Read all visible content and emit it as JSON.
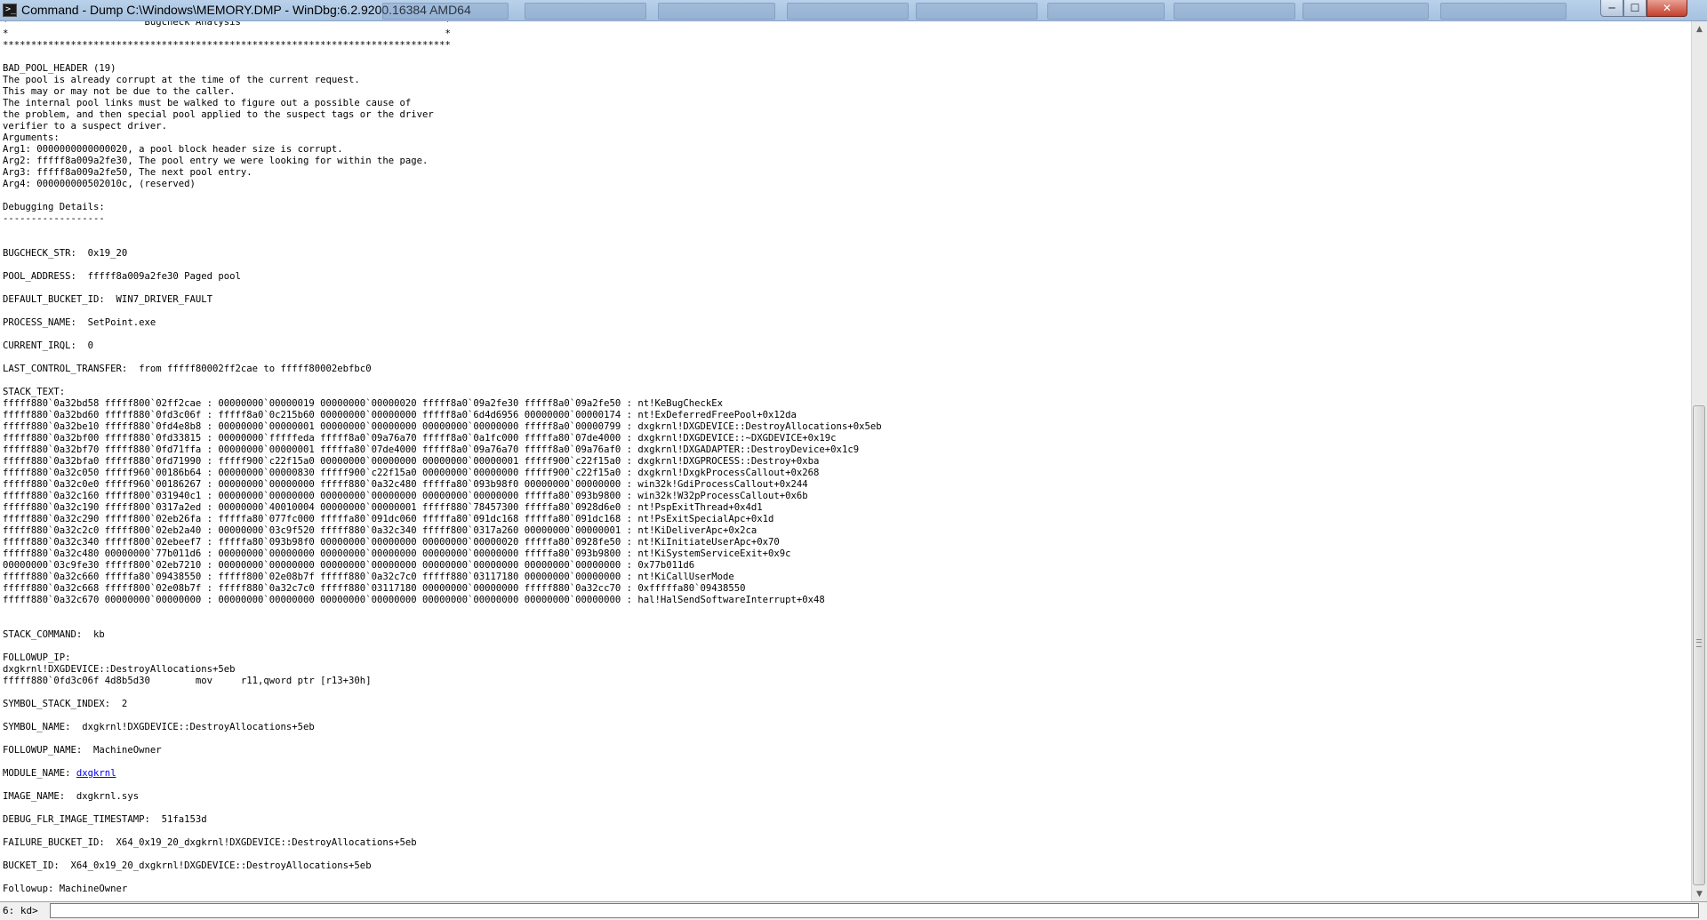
{
  "window": {
    "title": "Command - Dump C:\\Windows\\MEMORY.DMP - WinDbg:6.2.9200.16384 AMD64",
    "icon_glyph": ">_",
    "minimize_glyph": "─",
    "maximize_glyph": "☐",
    "close_glyph": "✕"
  },
  "output": {
    "text_before_link": "*                        Bugcheck Analysis                                    *\n*                                                                             *\n*******************************************************************************\n\nBAD_POOL_HEADER (19)\nThe pool is already corrupt at the time of the current request.\nThis may or may not be due to the caller.\nThe internal pool links must be walked to figure out a possible cause of\nthe problem, and then special pool applied to the suspect tags or the driver\nverifier to a suspect driver.\nArguments:\nArg1: 0000000000000020, a pool block header size is corrupt.\nArg2: fffff8a009a2fe30, The pool entry we were looking for within the page.\nArg3: fffff8a009a2fe50, The next pool entry.\nArg4: 000000000502010c, (reserved)\n\nDebugging Details:\n------------------\n\n\nBUGCHECK_STR:  0x19_20\n\nPOOL_ADDRESS:  fffff8a009a2fe30 Paged pool\n\nDEFAULT_BUCKET_ID:  WIN7_DRIVER_FAULT\n\nPROCESS_NAME:  SetPoint.exe\n\nCURRENT_IRQL:  0\n\nLAST_CONTROL_TRANSFER:  from fffff80002ff2cae to fffff80002ebfbc0\n\nSTACK_TEXT:\nfffff880`0a32bd58 fffff800`02ff2cae : 00000000`00000019 00000000`00000020 fffff8a0`09a2fe30 fffff8a0`09a2fe50 : nt!KeBugCheckEx\nfffff880`0a32bd60 fffff880`0fd3c06f : fffff8a0`0c215b60 00000000`00000000 fffff8a0`6d4d6956 00000000`00000174 : nt!ExDeferredFreePool+0x12da\nfffff880`0a32be10 fffff880`0fd4e8b8 : 00000000`00000001 00000000`00000000 00000000`00000000 fffff8a0`00000799 : dxgkrnl!DXGDEVICE::DestroyAllocations+0x5eb\nfffff880`0a32bf00 fffff880`0fd33815 : 00000000`fffffeda fffff8a0`09a76a70 fffff8a0`0a1fc000 fffffa80`07de4000 : dxgkrnl!DXGDEVICE::~DXGDEVICE+0x19c\nfffff880`0a32bf70 fffff880`0fd71ffa : 00000000`00000001 fffffa80`07de4000 fffff8a0`09a76a70 fffff8a0`09a76af0 : dxgkrnl!DXGADAPTER::DestroyDevice+0x1c9\nfffff880`0a32bfa0 fffff880`0fd71990 : fffff900`c22f15a0 00000000`00000000 00000000`00000001 fffff900`c22f15a0 : dxgkrnl!DXGPROCESS::Destroy+0xba\nfffff880`0a32c050 fffff960`00186b64 : 00000000`00000830 fffff900`c22f15a0 00000000`00000000 fffff900`c22f15a0 : dxgkrnl!DxgkProcessCallout+0x268\nfffff880`0a32c0e0 fffff960`00186267 : 00000000`00000000 fffff880`0a32c480 fffffa80`093b98f0 00000000`00000000 : win32k!GdiProcessCallout+0x244\nfffff880`0a32c160 fffff800`031940c1 : 00000000`00000000 00000000`00000000 00000000`00000000 fffffa80`093b9800 : win32k!W32pProcessCallout+0x6b\nfffff880`0a32c190 fffff800`0317a2ed : 00000000`40010004 00000000`00000001 fffff880`78457300 fffffa80`0928d6e0 : nt!PspExitThread+0x4d1\nfffff880`0a32c290 fffff800`02eb26fa : fffffa80`077fc000 fffffa80`091dc060 fffffa80`091dc168 fffffa80`091dc168 : nt!PsExitSpecialApc+0x1d\nfffff880`0a32c2c0 fffff800`02eb2a40 : 00000000`03c9f520 fffff880`0a32c340 fffff800`0317a260 00000000`00000001 : nt!KiDeliverApc+0x2ca\nfffff880`0a32c340 fffff800`02ebeef7 : fffffa80`093b98f0 00000000`00000000 00000000`00000020 fffffa80`0928fe50 : nt!KiInitiateUserApc+0x70\nfffff880`0a32c480 00000000`77b011d6 : 00000000`00000000 00000000`00000000 00000000`00000000 fffffa80`093b9800 : nt!KiSystemServiceExit+0x9c\n00000000`03c9fe30 fffff800`02eb7210 : 00000000`00000000 00000000`00000000 00000000`00000000 00000000`00000000 : 0x77b011d6\nfffff880`0a32c660 fffffa80`09438550 : fffff800`02e08b7f fffff880`0a32c7c0 fffff880`03117180 00000000`00000000 : nt!KiCallUserMode\nfffff880`0a32c668 fffff800`02e08b7f : fffff880`0a32c7c0 fffff880`03117180 00000000`00000000 fffff880`0a32cc70 : 0xfffffa80`09438550\nfffff880`0a32c670 00000000`00000000 : 00000000`00000000 00000000`00000000 00000000`00000000 00000000`00000000 : hal!HalSendSoftwareInterrupt+0x48\n\n\nSTACK_COMMAND:  kb\n\nFOLLOWUP_IP:\ndxgkrnl!DXGDEVICE::DestroyAllocations+5eb\nfffff880`0fd3c06f 4d8b5d30        mov     r11,qword ptr [r13+30h]\n\nSYMBOL_STACK_INDEX:  2\n\nSYMBOL_NAME:  dxgkrnl!DXGDEVICE::DestroyAllocations+5eb\n\nFOLLOWUP_NAME:  MachineOwner\n\nMODULE_NAME: ",
    "module_link": "dxgkrnl",
    "text_after_link": "\n\nIMAGE_NAME:  dxgkrnl.sys\n\nDEBUG_FLR_IMAGE_TIMESTAMP:  51fa153d\n\nFAILURE_BUCKET_ID:  X64_0x19_20_dxgkrnl!DXGDEVICE::DestroyAllocations+5eb\n\nBUCKET_ID:  X64_0x19_20_dxgkrnl!DXGDEVICE::DestroyAllocations+5eb\n\nFollowup: MachineOwner"
  },
  "scrollbar": {
    "up_glyph": "▲",
    "down_glyph": "▼"
  },
  "command": {
    "prompt": "6: kd>",
    "value": ""
  }
}
